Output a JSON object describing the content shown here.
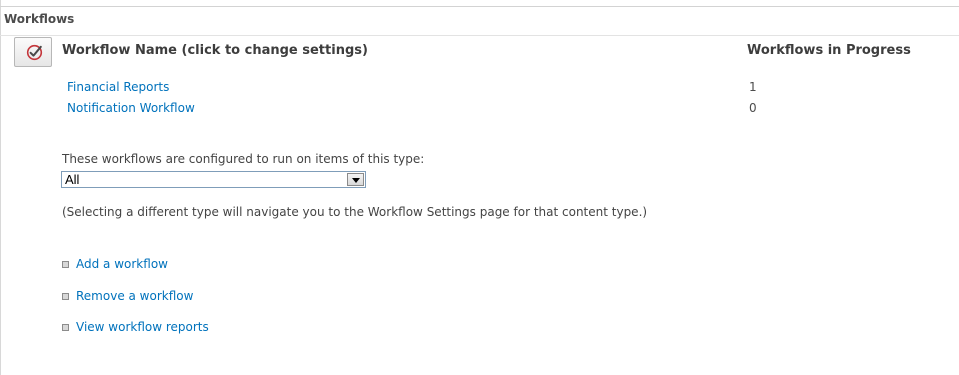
{
  "section": {
    "title": "Workflows"
  },
  "table": {
    "icon": "workflow-settings-icon",
    "columns": {
      "name": "Workflow Name (click to change settings)",
      "in_progress": "Workflows in Progress"
    },
    "rows": [
      {
        "name": "Financial Reports",
        "in_progress": "1"
      },
      {
        "name": "Notification Workflow",
        "in_progress": "0"
      }
    ]
  },
  "content_type": {
    "label": "These workflows are configured to run on items of this type:",
    "selected": "All",
    "note": "(Selecting a different type will navigate you to the Workflow Settings page for that content type.)"
  },
  "actions": [
    {
      "label": "Add a workflow",
      "icon": "square-bullet-icon"
    },
    {
      "label": "Remove a workflow",
      "icon": "square-bullet-icon"
    },
    {
      "label": "View workflow reports",
      "icon": "square-bullet-icon"
    }
  ],
  "colors": {
    "link": "#0072bc",
    "icon_accent": "#c4363b",
    "header_text": "#3d3d3d"
  }
}
